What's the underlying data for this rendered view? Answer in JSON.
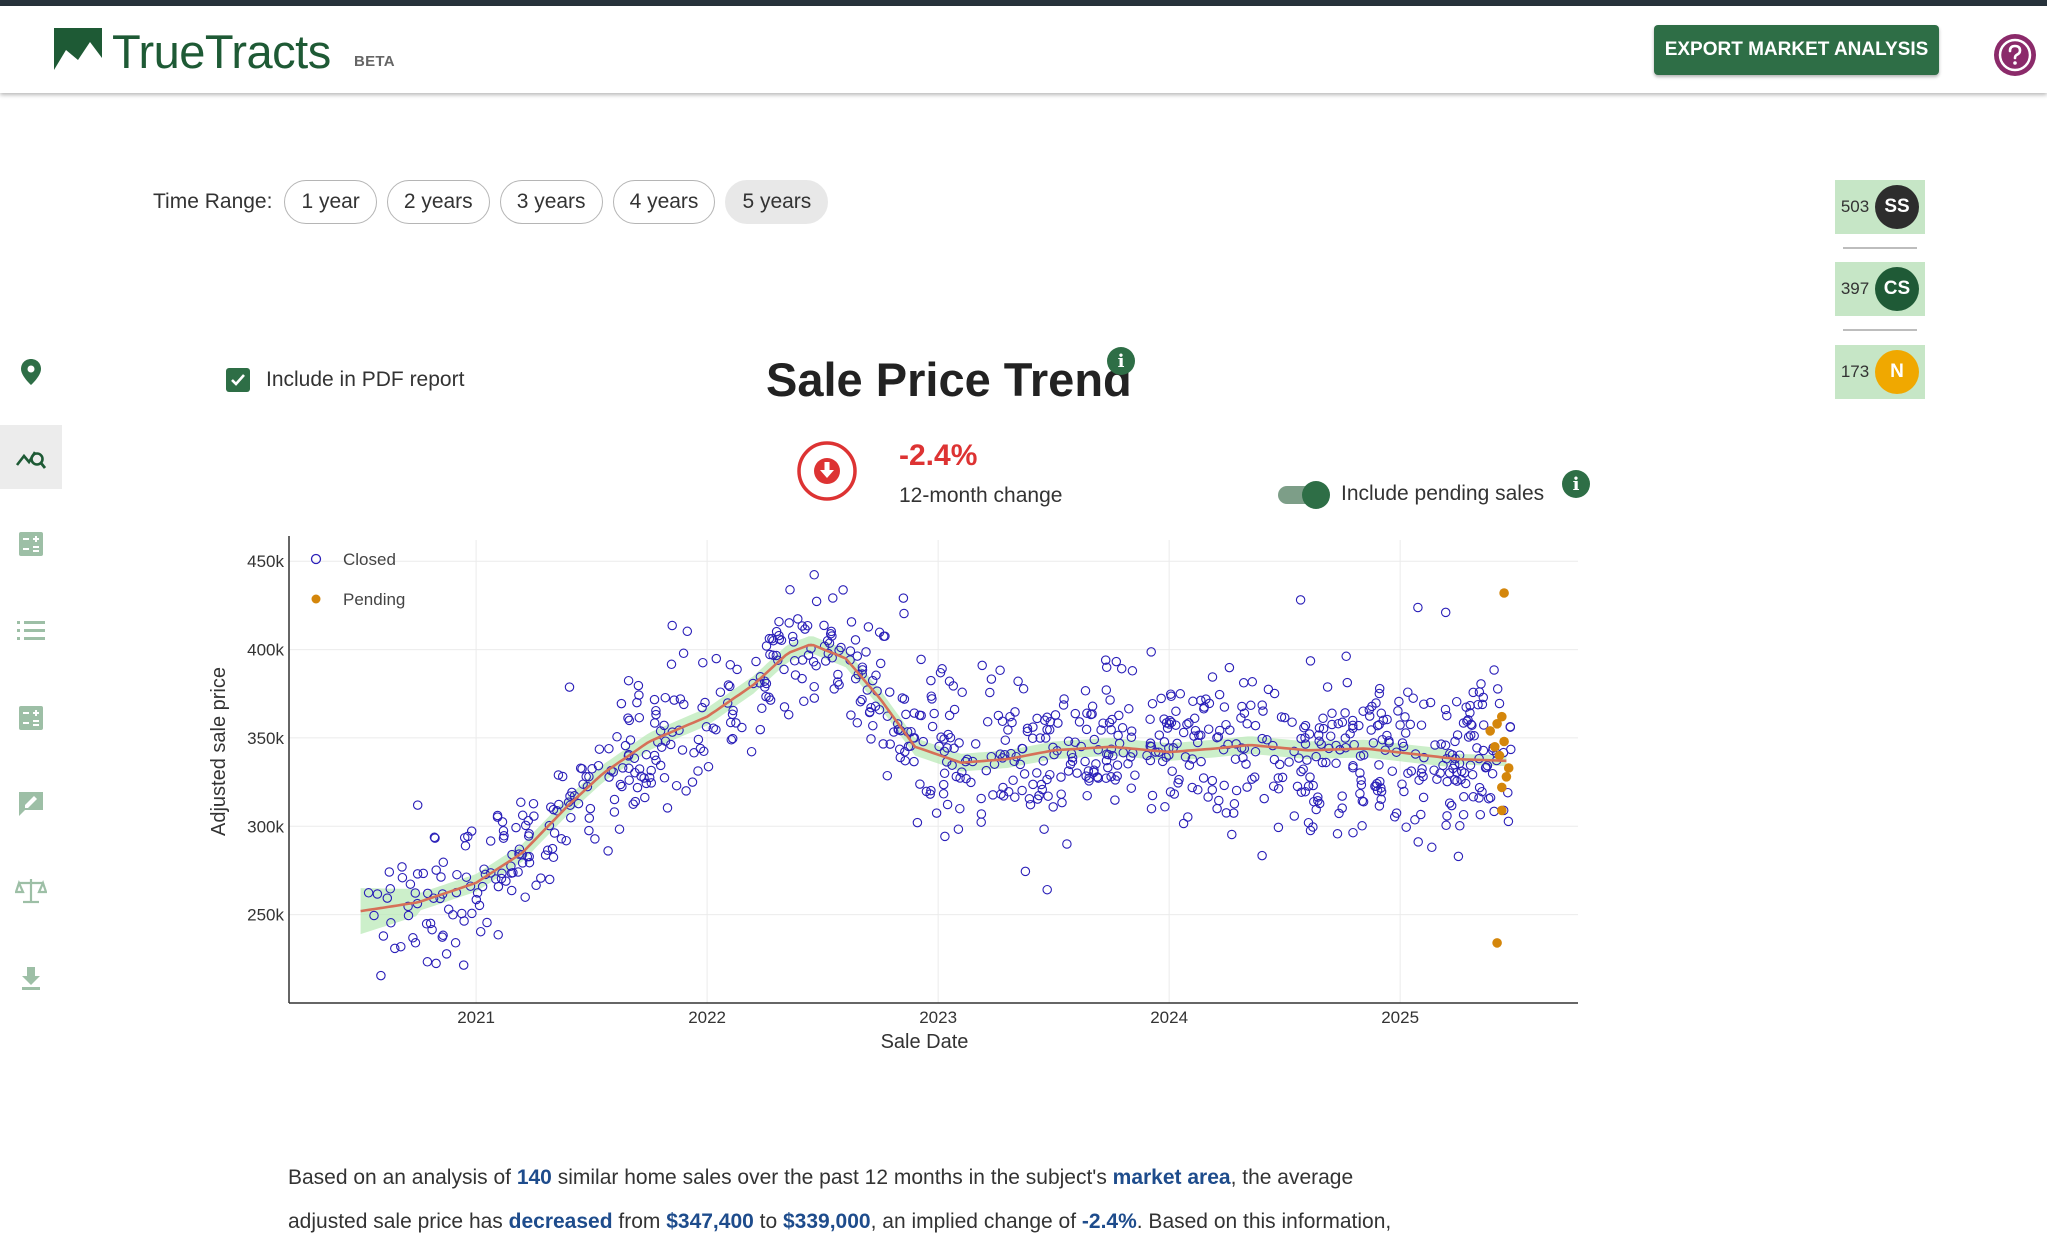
{
  "app": {
    "logo_text": "TrueTracts",
    "logo_badge": "BETA",
    "export_button": "EXPORT MARKET ANALYSIS",
    "help_icon": "help-circle-icon"
  },
  "sidebar": {
    "items": [
      {
        "icon": "map-pin-icon",
        "active": false
      },
      {
        "icon": "trend-search-icon",
        "active": true
      },
      {
        "icon": "calculator-icon",
        "active": false
      },
      {
        "icon": "list-icon",
        "active": false
      },
      {
        "icon": "calculator-icon",
        "active": false
      },
      {
        "icon": "feedback-edit-icon",
        "active": false
      },
      {
        "icon": "balance-scale-icon",
        "active": false
      },
      {
        "icon": "download-icon",
        "active": false
      }
    ]
  },
  "time_range": {
    "label": "Time Range:",
    "options": [
      "1 year",
      "2 years",
      "3 years",
      "4 years",
      "5 years"
    ],
    "selected": "5 years"
  },
  "counts": [
    {
      "value": "503",
      "badge": "SS",
      "color": "#2d2d2d"
    },
    {
      "value": "397",
      "badge": "CS",
      "color": "#1f5a36"
    },
    {
      "value": "173",
      "badge": "N",
      "color": "#f0a800"
    }
  ],
  "report": {
    "include_pdf_label": "Include in PDF report",
    "include_pdf_checked": true
  },
  "chart_header": {
    "title": "Sale Price Trend",
    "change_value": "-2.4%",
    "change_label": "12-month change",
    "change_direction": "down",
    "pending_toggle_label": "Include pending sales",
    "pending_toggle_on": true
  },
  "chart_data": {
    "type": "scatter",
    "xlabel": "Sale Date",
    "ylabel": "Adjusted sale price",
    "x_ticks": [
      "2021",
      "2022",
      "2023",
      "2024",
      "2025"
    ],
    "y_ticks": [
      "250k",
      "300k",
      "350k",
      "400k",
      "450k"
    ],
    "xlim": [
      2020.19,
      2025.77
    ],
    "ylim": [
      200000,
      462000
    ],
    "grid": true,
    "legend_position": "top-left",
    "series": [
      {
        "name": "Closed",
        "marker": "open-circle",
        "color": "#2a1fb8",
        "trend": [
          [
            2020.5,
            252000
          ],
          [
            2020.75,
            257000
          ],
          [
            2021.0,
            268000
          ],
          [
            2021.2,
            285000
          ],
          [
            2021.4,
            312000
          ],
          [
            2021.55,
            330000
          ],
          [
            2021.75,
            348000
          ],
          [
            2022.0,
            362000
          ],
          [
            2022.2,
            380000
          ],
          [
            2022.35,
            398000
          ],
          [
            2022.45,
            403000
          ],
          [
            2022.6,
            395000
          ],
          [
            2022.75,
            372000
          ],
          [
            2022.9,
            345000
          ],
          [
            2023.1,
            336000
          ],
          [
            2023.3,
            338000
          ],
          [
            2023.5,
            343000
          ],
          [
            2023.75,
            345000
          ],
          [
            2024.0,
            342000
          ],
          [
            2024.2,
            344000
          ],
          [
            2024.35,
            346000
          ],
          [
            2024.6,
            343000
          ],
          [
            2024.85,
            344000
          ],
          [
            2025.05,
            341000
          ],
          [
            2025.25,
            338000
          ],
          [
            2025.47,
            337000
          ]
        ]
      },
      {
        "name": "Pending",
        "marker": "filled-circle",
        "color": "#d4860b",
        "points": [
          [
            2025.45,
            432000
          ],
          [
            2025.44,
            362000
          ],
          [
            2025.42,
            358000
          ],
          [
            2025.45,
            348000
          ],
          [
            2025.41,
            345000
          ],
          [
            2025.43,
            340000
          ],
          [
            2025.47,
            333000
          ],
          [
            2025.44,
            322000
          ],
          [
            2025.44,
            309000
          ],
          [
            2025.42,
            234000
          ],
          [
            2025.46,
            328000
          ],
          [
            2025.39,
            354000
          ]
        ]
      }
    ]
  },
  "summary": {
    "p1": "Based on an analysis of ",
    "count": "140",
    "p2": " similar home sales over the past 12 months in the subject's ",
    "area": "market area",
    "p3": ", the average",
    "p4": "adjusted sale price has ",
    "direction": "decreased",
    "p5": " from ",
    "from_price": "$347,400",
    "p6": " to ",
    "to_price": "$339,000",
    "p7": ", an implied change of ",
    "pct": "-2.4%",
    "p8": ". Based on this information,"
  }
}
